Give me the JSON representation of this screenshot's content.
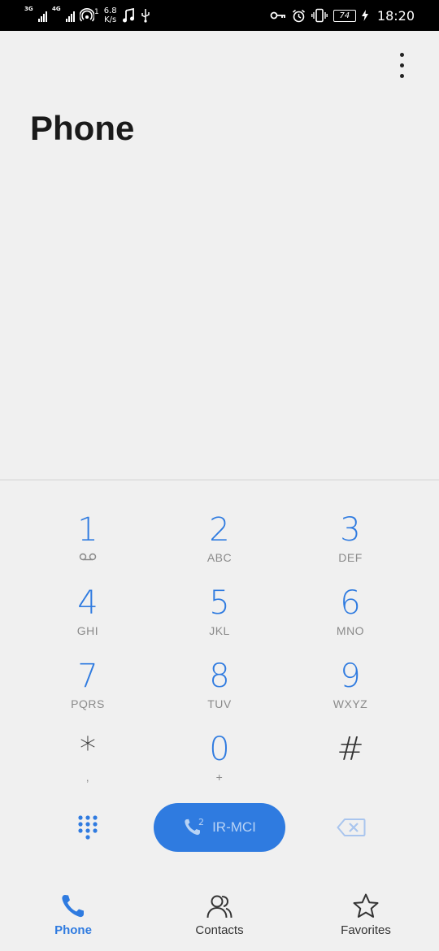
{
  "status_bar": {
    "signal1_tag": "3G",
    "signal2_tag": "4G",
    "hotspot_count": "1",
    "speed_value": "6.8",
    "speed_unit": "K/s",
    "battery": "74",
    "time": "18:20"
  },
  "header": {
    "title": "Phone",
    "more_icon": "more-vert-icon"
  },
  "dialpad": {
    "keys": [
      {
        "digit": "1",
        "letters": ""
      },
      {
        "digit": "2",
        "letters": "ABC"
      },
      {
        "digit": "3",
        "letters": "DEF"
      },
      {
        "digit": "4",
        "letters": "GHI"
      },
      {
        "digit": "5",
        "letters": "JKL"
      },
      {
        "digit": "6",
        "letters": "MNO"
      },
      {
        "digit": "7",
        "letters": "PQRS"
      },
      {
        "digit": "8",
        "letters": "TUV"
      },
      {
        "digit": "9",
        "letters": "WXYZ"
      },
      {
        "digit": "*",
        "letters": ","
      },
      {
        "digit": "0",
        "letters": "+"
      },
      {
        "digit": "#",
        "letters": ""
      }
    ]
  },
  "actions": {
    "call_sim_number": "2",
    "call_label": "IR-MCI"
  },
  "bottom_nav": {
    "items": [
      {
        "label": "Phone",
        "icon": "phone-icon",
        "active": true
      },
      {
        "label": "Contacts",
        "icon": "contacts-icon",
        "active": false
      },
      {
        "label": "Favorites",
        "icon": "star-icon",
        "active": false
      }
    ]
  },
  "colors": {
    "accent": "#2f7be0",
    "background": "#f0f0f0",
    "status_bar": "#000000"
  }
}
